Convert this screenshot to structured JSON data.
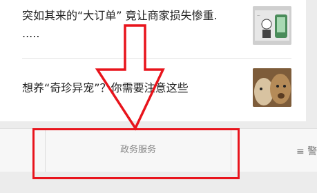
{
  "feed": {
    "items": [
      {
        "title_line1": "突如其来的“大订单” 竟让商家损失惨重.",
        "title_line2": "....."
      },
      {
        "title_line1": "想养“奇珍异宠”？你需要注意这些"
      }
    ]
  },
  "bottom_bar": {
    "gov_tab_label": "政务服务",
    "right_tab_icon": "menu-icon",
    "right_tab_label": "警"
  },
  "annotation": {
    "color": "#e8141c"
  }
}
